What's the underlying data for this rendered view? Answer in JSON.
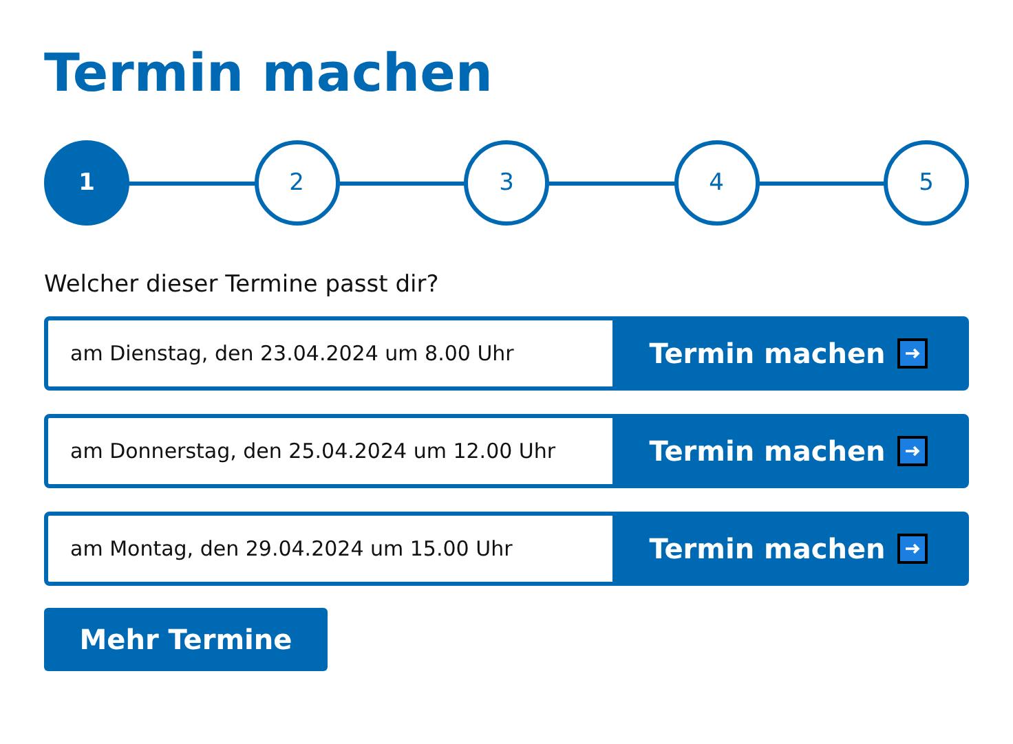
{
  "title": "Termin machen",
  "steps": [
    {
      "label": "1",
      "selected": true
    },
    {
      "label": "2",
      "selected": false
    },
    {
      "label": "3",
      "selected": false
    },
    {
      "label": "4",
      "selected": false
    },
    {
      "label": "5",
      "selected": false
    }
  ],
  "question": "Welcher dieser Termine passt dir?",
  "appointments": [
    {
      "date": "am Dienstag, den 23.04.2024 um 8.00 Uhr",
      "button": "Termin machen"
    },
    {
      "date": "am Donnerstag, den 25.04.2024 um 12.00 Uhr",
      "button": "Termin machen"
    },
    {
      "date": "am Montag, den 29.04.2024 um 15.00 Uhr",
      "button": "Termin machen"
    }
  ],
  "more_button": "Mehr Termine"
}
